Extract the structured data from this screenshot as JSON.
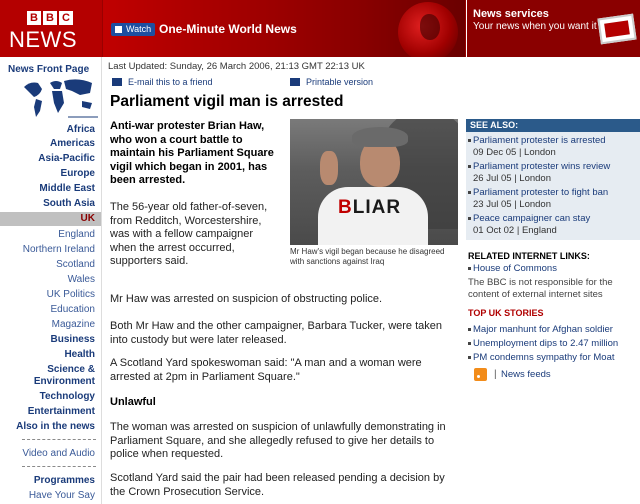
{
  "header": {
    "bbc_letters": [
      "B",
      "B",
      "C"
    ],
    "logo_word": "NEWS",
    "watch_label": "Watch",
    "banner_title": "One-Minute World News",
    "services_title": "News services",
    "services_text": "Your news when you want it"
  },
  "nav": {
    "front_page": "News Front Page",
    "items": [
      {
        "label": "Africa",
        "style": "bold"
      },
      {
        "label": "Americas",
        "style": "bold"
      },
      {
        "label": "Asia-Pacific",
        "style": "bold"
      },
      {
        "label": "Europe",
        "style": "bold"
      },
      {
        "label": "Middle East",
        "style": "bold"
      },
      {
        "label": "South Asia",
        "style": "bold"
      },
      {
        "label": "UK",
        "style": "bold"
      },
      {
        "label": "England",
        "style": "sub"
      },
      {
        "label": "Northern Ireland",
        "style": "sub"
      },
      {
        "label": "Scotland",
        "style": "sub"
      },
      {
        "label": "Wales",
        "style": "sub"
      },
      {
        "label": "UK Politics",
        "style": "sub"
      },
      {
        "label": "Education",
        "style": "sub"
      },
      {
        "label": "Magazine",
        "style": "sub"
      },
      {
        "label": "Business",
        "style": "bold"
      },
      {
        "label": "Health",
        "style": "bold"
      },
      {
        "label": "Science & Environment",
        "style": "bold"
      },
      {
        "label": "Technology",
        "style": "bold"
      },
      {
        "label": "Entertainment",
        "style": "bold"
      },
      {
        "label": "Also in the news",
        "style": "bold"
      },
      {
        "label": "Video and Audio",
        "style": "sub"
      },
      {
        "label": "Programmes",
        "style": "bold"
      },
      {
        "label": "Have Your Say",
        "style": "sub"
      }
    ]
  },
  "article": {
    "updated": "Last Updated: Sunday, 26 March 2006, 21:13 GMT 22:13 UK",
    "email_link": "E-mail this to a friend",
    "print_link": "Printable version",
    "headline": "Parliament vigil man is arrested",
    "lead": "Anti-war protester Brian Haw, who won a court battle to maintain his Parliament Square vigil which began in 2001, has been arrested.",
    "photo_slogan_prefix": "B",
    "photo_slogan_rest": "LIAR",
    "caption": "Mr Haw's vigil began because he disagreed with sanctions against Iraq",
    "paragraphs": [
      "The 56-year old father-of-seven, from Redditch, Worcestershire, was with a fellow campaigner when the arrest occurred, supporters said.",
      "Mr Haw was arrested on suspicion of obstructing police.",
      "Both Mr Haw and the other campaigner, Barbara Tucker, were taken into custody but were later released.",
      "A Scotland Yard spokeswoman said: \"A man and a woman were arrested at 2pm in Parliament Square.\"",
      "The woman was arrested on suspicion of unlawfully demonstrating in Parliament Square, and she allegedly refused to give her details to police when requested.",
      "Scotland Yard said the pair had been released pending a decision by the Crown Prosecution Service."
    ],
    "subhead": "Unlawful"
  },
  "sidebar": {
    "see_also_title": "SEE ALSO:",
    "see_also": [
      {
        "title": "Parliament protester is arrested",
        "date": "09 Dec 05 |  London"
      },
      {
        "title": "Parliament protester wins review",
        "date": "26 Jul 05 |  London"
      },
      {
        "title": "Parliament protester to fight ban",
        "date": "23 Jul 05 |  London"
      },
      {
        "title": "Peace campaigner can stay",
        "date": "01 Oct 02 |  England"
      }
    ],
    "related_title": "RELATED INTERNET LINKS:",
    "related_link": "House of Commons",
    "related_note": "The BBC is not responsible for the content of external internet sites",
    "top_title": "TOP UK STORIES",
    "top_stories": [
      "Major manhunt for Afghan soldier",
      "Unemployment dips to 2.47 million",
      "PM condemns sympathy for Moat"
    ],
    "rss_pipe": "|",
    "news_feeds": "News feeds"
  }
}
